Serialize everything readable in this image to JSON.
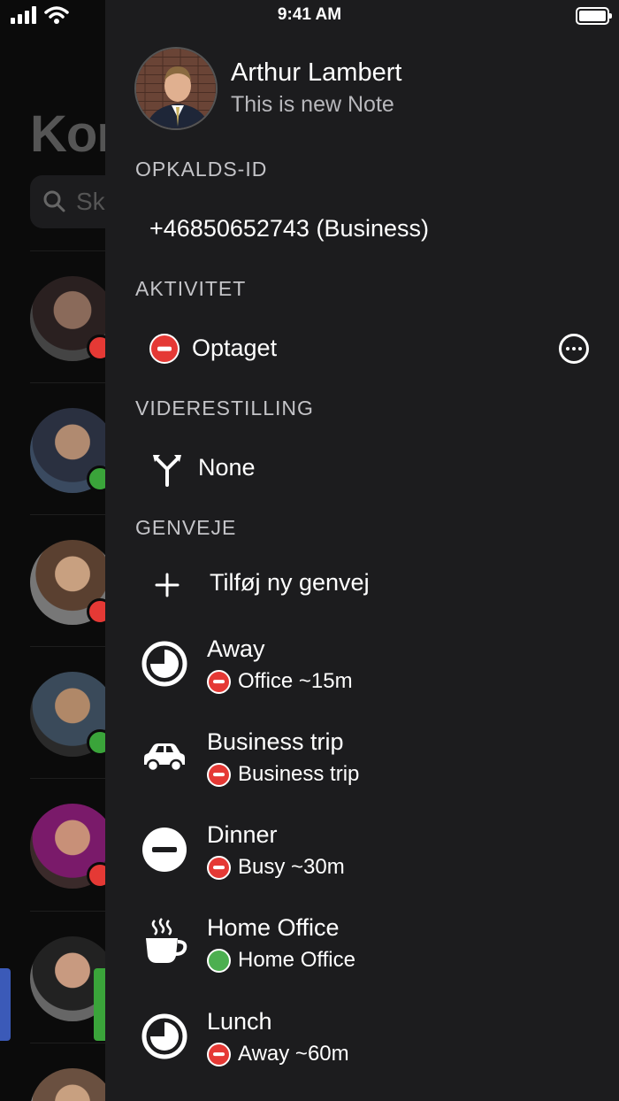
{
  "status_bar": {
    "time": "9:41 AM"
  },
  "background": {
    "title": "Kon",
    "search_placeholder": "Sk"
  },
  "profile": {
    "name": "Arthur Lambert",
    "note": "This is new Note"
  },
  "sections": {
    "caller_id": "OPKALDS-ID",
    "activity": "AKTIVITET",
    "forwarding": "VIDERESTILLING",
    "shortcuts": "GENVEJE"
  },
  "caller_id_value": "+46850652743 (Business)",
  "activity_value": "Optaget",
  "forwarding_value": "None",
  "add_shortcut_label": "Tilføj ny genvej",
  "shortcuts": [
    {
      "title": "Away",
      "subtitle": "Office ~15m",
      "icon": "clock-icon",
      "status": "busy"
    },
    {
      "title": "Business trip",
      "subtitle": "Business trip",
      "icon": "car-icon",
      "status": "busy"
    },
    {
      "title": "Dinner",
      "subtitle": "Busy ~30m",
      "icon": "minus-circle-icon",
      "status": "busy"
    },
    {
      "title": "Home Office",
      "subtitle": "Home Office",
      "icon": "coffee-icon",
      "status": "available"
    },
    {
      "title": "Lunch",
      "subtitle": "Away ~60m",
      "icon": "clock-icon",
      "status": "busy"
    }
  ],
  "colors": {
    "drawer_bg": "#1c1c1e",
    "busy_red": "#e53935",
    "available_green": "#4caf50"
  }
}
